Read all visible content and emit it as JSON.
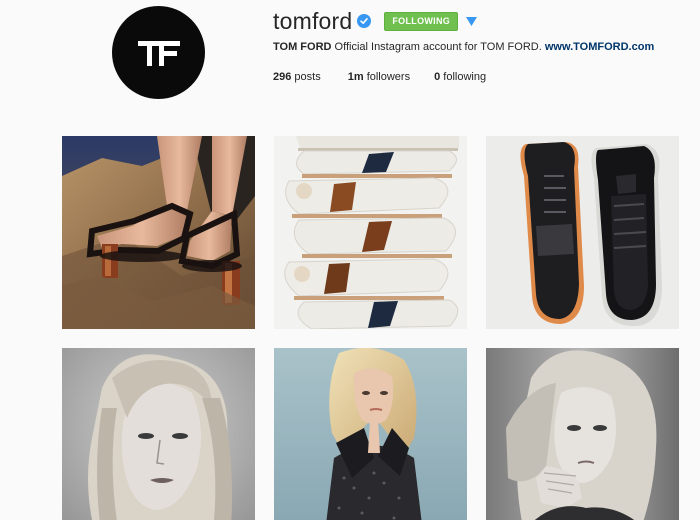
{
  "profile": {
    "username": "tomford",
    "avatar_text": "TF",
    "follow_label": "FOLLOWING",
    "bio_name": "TOM FORD",
    "bio_text": "Official Instagram account for TOM FORD.",
    "bio_link": "www.TOMFORD.com",
    "stats": [
      {
        "count": "296",
        "label": "posts"
      },
      {
        "count": "1m",
        "label": "followers"
      },
      {
        "count": "0",
        "label": "following"
      }
    ]
  },
  "icons": {
    "verified": "verified-check-icon",
    "dropdown": "caret-down-icon"
  },
  "colors": {
    "following_green": "#70c050",
    "verified_blue": "#3897f0",
    "link_blue": "#003569",
    "avatar_black": "#0a0a0a"
  },
  "posts": [
    {
      "subject": "heeled sandals on rock"
    },
    {
      "subject": "stacked sneakers"
    },
    {
      "subject": "black sneakers"
    },
    {
      "subject": "model portrait"
    },
    {
      "subject": "model in sequin dress"
    },
    {
      "subject": "model with hand on chin"
    }
  ]
}
